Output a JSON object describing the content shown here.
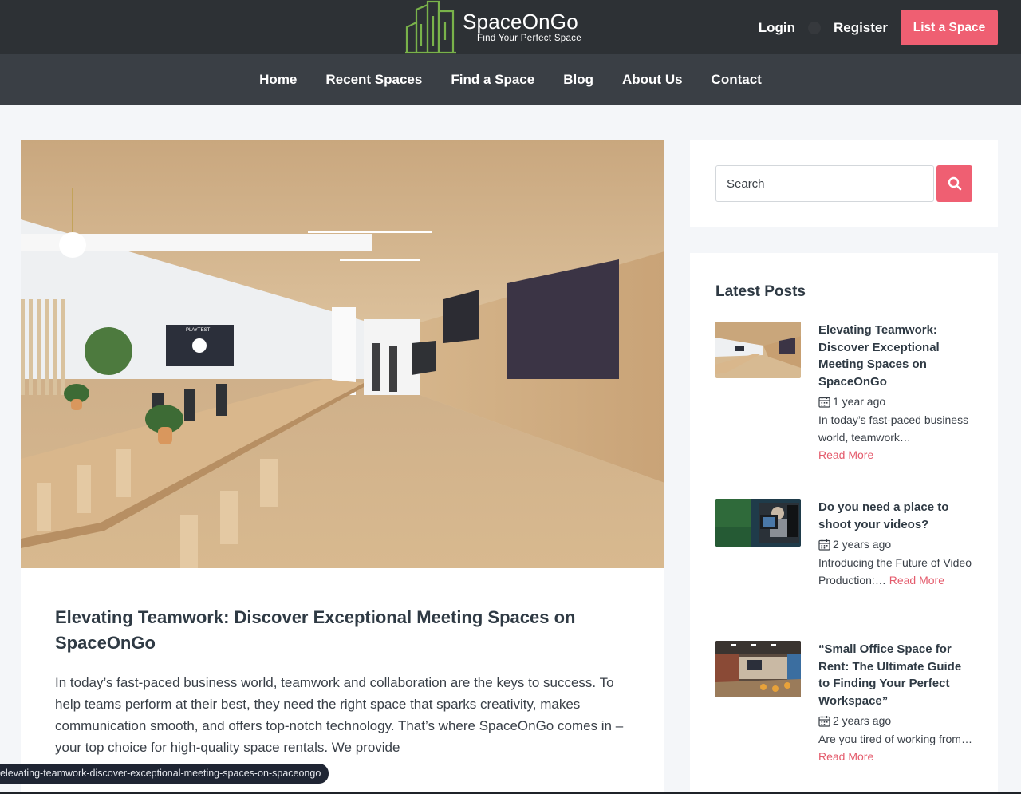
{
  "header": {
    "logo_name": "SpaceOnGo",
    "logo_tagline": "Find Your Perfect Space",
    "login_label": "Login",
    "register_label": "Register",
    "list_space_label": "List a Space"
  },
  "nav": {
    "items": [
      "Home",
      "Recent Spaces",
      "Find a Space",
      "Blog",
      "About Us",
      "Contact"
    ]
  },
  "article": {
    "title": "Elevating Teamwork: Discover Exceptional Meeting Spaces on SpaceOnGo",
    "excerpt": "In today’s fast-paced business world, teamwork and collaboration are the keys to success. To help teams perform at their best, they need the right space that sparks creativity, makes communication smooth, and offers top-notch technology. That’s where SpaceOnGo comes in – your top choice for high-quality space rentals. We provide",
    "tv_label": "PLAYTEST"
  },
  "sidebar": {
    "search_placeholder": "Search",
    "latest_heading": "Latest Posts",
    "posts": [
      {
        "title": "Elevating Teamwork: Discover Exceptional Meeting Spaces on SpaceOnGo",
        "date": "1 year ago",
        "excerpt": "In today’s fast-paced business world, teamwork…",
        "read_more": "Read More"
      },
      {
        "title": "Do you need a place to shoot your videos?",
        "date": "2 years ago",
        "excerpt": "Introducing the Future of Video Production:…",
        "read_more": "Read More"
      },
      {
        "title": "“Small Office Space for Rent: The Ultimate Guide to Finding Your Perfect Workspace”",
        "date": "2 years ago",
        "excerpt": "Are you tired of working from…",
        "read_more": "Read More"
      }
    ]
  },
  "status_bar": {
    "url": "elevating-teamwork-discover-exceptional-meeting-spaces-on-spaceongo"
  },
  "colors": {
    "accent": "#ef5f72",
    "header_bg": "#2d3135",
    "nav_bg": "#3a3f45",
    "page_bg": "#f4f6f9"
  }
}
